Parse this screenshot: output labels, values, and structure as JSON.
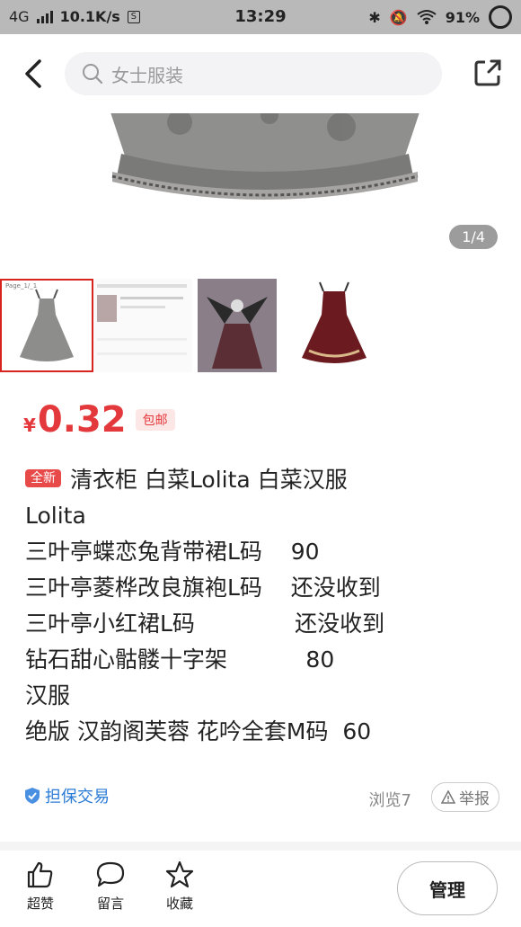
{
  "status_bar": {
    "network": "4G",
    "speed": "10.1K/s",
    "s_icon": "S",
    "time": "13:29",
    "battery": "91%"
  },
  "search": {
    "placeholder": "女士服装"
  },
  "gallery": {
    "page_indicator": "1/4",
    "thumb_caption": "Page_1/_1"
  },
  "price": {
    "currency": "¥",
    "value": "0.32",
    "shipping": "包邮"
  },
  "description": {
    "tag": "全新",
    "lines": [
      "清衣柜 白菜Lolita 白菜汉服",
      "Lolita",
      "三叶亭蝶恋兔背带裙L码    90",
      "三叶亭菱桦改良旗袍L码    还没收到",
      "三叶亭小红裙L码              还没收到",
      "钻石甜心骷髅十字架           80",
      "汉服",
      "绝版 汉韵阁芙蓉 花吟全套M码  60"
    ]
  },
  "meta": {
    "guarantee": "担保交易",
    "views": "浏览7",
    "report": "举报"
  },
  "bottom": {
    "like": "超赞",
    "comment": "留言",
    "favorite": "收藏",
    "manage": "管理"
  }
}
